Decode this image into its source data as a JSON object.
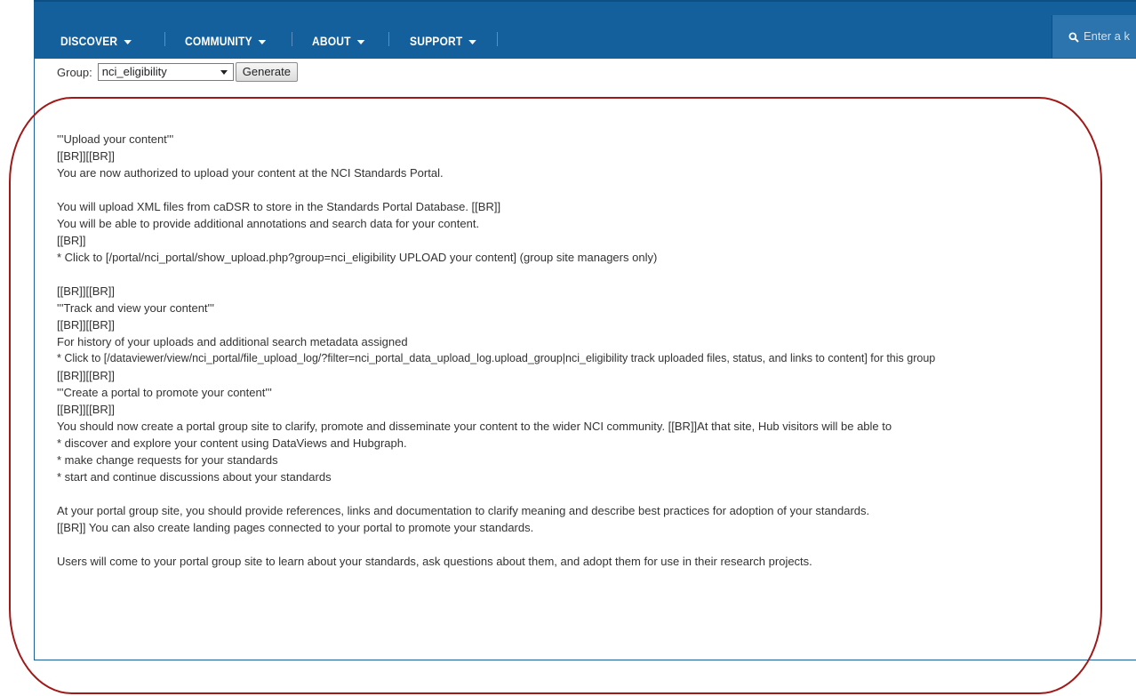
{
  "nav": {
    "items": [
      {
        "label": "DISCOVER"
      },
      {
        "label": "COMMUNITY"
      },
      {
        "label": "ABOUT"
      },
      {
        "label": "SUPPORT"
      }
    ],
    "search_placeholder": "Enter a k"
  },
  "group_form": {
    "label": "Group:",
    "selected": "nci_eligibility",
    "button": "Generate"
  },
  "content_lines": [
    "'''Upload your content'''",
    "[[BR]][[BR]]",
    "You are now authorized to upload your content at the NCI Standards Portal.",
    "",
    "You will upload XML files from caDSR to store in the Standards Portal Database. [[BR]]",
    "You will be able to provide additional annotations and search data for your content.",
    "[[BR]]",
    " * Click to [/portal/nci_portal/show_upload.php?group=nci_eligibility UPLOAD your content] (group site managers only)",
    "",
    "[[BR]][[BR]]",
    "'''Track and view your content'''",
    "[[BR]][[BR]]",
    "For history of your uploads and additional search metadata assigned",
    " * Click to [/dataviewer/view/nci_portal/file_upload_log/?filter=nci_portal_data_upload_log.upload_group|nci_eligibility track uploaded files, status, and links to content] for this group",
    "[[BR]][[BR]]",
    "'''Create a portal to promote your content'''",
    "[[BR]][[BR]]",
    "You should now create a portal group site to clarify, promote and disseminate your content to the wider NCI community. [[BR]]At that site, Hub visitors will be able to",
    " * discover and explore your content using DataViews and Hubgraph.",
    " * make change requests for your standards",
    " * start and continue discussions about your standards",
    "",
    "At your portal group site, you should provide references, links and documentation to clarify meaning and describe best practices for adoption of your standards.",
    "[[BR]] You can also create landing pages connected to your portal to promote your standards.",
    "",
    "Users will come to your portal group site to learn about your standards, ask questions about them, and adopt them for use in their research projects."
  ],
  "colors": {
    "navbar": "#13609d",
    "annotation": "#a01818",
    "text": "#333333"
  }
}
